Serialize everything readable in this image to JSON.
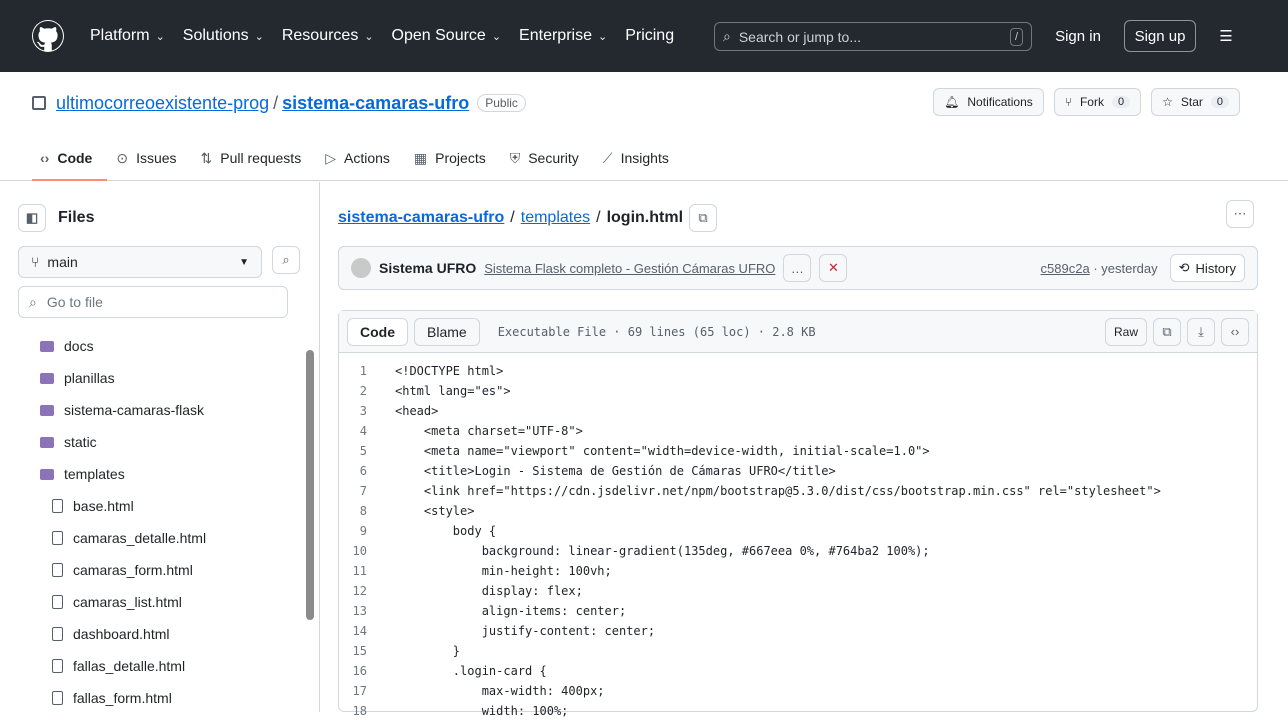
{
  "header": {
    "nav": [
      {
        "label": "Platform",
        "dropdown": true
      },
      {
        "label": "Solutions",
        "dropdown": true
      },
      {
        "label": "Resources",
        "dropdown": true
      },
      {
        "label": "Open Source",
        "dropdown": true
      },
      {
        "label": "Enterprise",
        "dropdown": true
      },
      {
        "label": "Pricing",
        "dropdown": false
      }
    ],
    "search_placeholder": "Search or jump to...",
    "search_shortcut": "/",
    "sign_in": "Sign in",
    "sign_up": "Sign up"
  },
  "repo": {
    "owner": "ultimocorreoexistente-prog",
    "separator": "/",
    "name": "sistema-camaras-ufro",
    "visibility": "Public",
    "notifications": "Notifications",
    "fork_label": "Fork",
    "fork_count": "0",
    "star_label": "Star",
    "star_count": "0"
  },
  "tabs": [
    "Code",
    "Issues",
    "Pull requests",
    "Actions",
    "Projects",
    "Security",
    "Insights"
  ],
  "sidebar": {
    "title": "Files",
    "branch": "main",
    "goto_placeholder": "Go to file",
    "tree": [
      {
        "name": "docs",
        "type": "folder"
      },
      {
        "name": "planillas",
        "type": "folder"
      },
      {
        "name": "sistema-camaras-flask",
        "type": "folder"
      },
      {
        "name": "static",
        "type": "folder"
      },
      {
        "name": "templates",
        "type": "folder-open"
      },
      {
        "name": "base.html",
        "type": "file"
      },
      {
        "name": "camaras_detalle.html",
        "type": "file"
      },
      {
        "name": "camaras_form.html",
        "type": "file"
      },
      {
        "name": "camaras_list.html",
        "type": "file"
      },
      {
        "name": "dashboard.html",
        "type": "file"
      },
      {
        "name": "fallas_detalle.html",
        "type": "file"
      },
      {
        "name": "fallas_form.html",
        "type": "file"
      }
    ]
  },
  "breadcrumb": {
    "repo": "sistema-camaras-ufro",
    "folder": "templates",
    "file": "login.html",
    "sep": "/"
  },
  "commit": {
    "author": "Sistema UFRO",
    "message": "Sistema Flask completo - Gestión Cámaras UFRO",
    "sha": "c589c2a",
    "time": "· yesterday",
    "history": "History"
  },
  "fileview": {
    "code_tab": "Code",
    "blame_tab": "Blame",
    "meta": "Executable File · 69 lines (65 loc) · 2.8 KB",
    "raw": "Raw",
    "lines": [
      "<!DOCTYPE html>",
      "<html lang=\"es\">",
      "<head>",
      "    <meta charset=\"UTF-8\">",
      "    <meta name=\"viewport\" content=\"width=device-width, initial-scale=1.0\">",
      "    <title>Login - Sistema de Gestión de Cámaras UFRO</title>",
      "    <link href=\"https://cdn.jsdelivr.net/npm/bootstrap@5.3.0/dist/css/bootstrap.min.css\" rel=\"stylesheet\">",
      "    <style>",
      "        body {",
      "            background: linear-gradient(135deg, #667eea 0%, #764ba2 100%);",
      "            min-height: 100vh;",
      "            display: flex;",
      "            align-items: center;",
      "            justify-content: center;",
      "        }",
      "        .login-card {",
      "            max-width: 400px;",
      "            width: 100%;"
    ]
  }
}
